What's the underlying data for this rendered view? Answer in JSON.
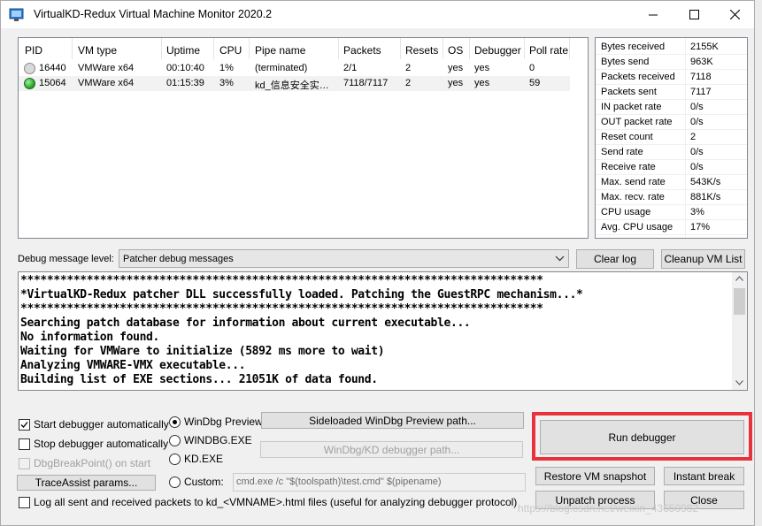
{
  "window": {
    "title": "VirtualKD-Redux Virtual Machine Monitor 2020.2",
    "controls": {
      "minimize": "—",
      "maximize": "☐",
      "close": "✕"
    }
  },
  "process_list": {
    "columns": [
      "PID",
      "VM type",
      "Uptime",
      "CPU",
      "Pipe name",
      "Packets",
      "Resets",
      "OS",
      "Debugger",
      "Poll rate"
    ],
    "rows": [
      {
        "status": "idle",
        "status_color": "#d9d9d9",
        "pid": "16440",
        "vm_type": "VMWare x64",
        "uptime": "00:10:40",
        "cpu": "1%",
        "pipe": "(terminated)",
        "packets": "2/1",
        "resets": "2",
        "os": "yes",
        "debugger": "yes",
        "poll_rate": "0"
      },
      {
        "status": "active",
        "status_color": "#2eaa2e",
        "pid": "15064",
        "vm_type": "VMWare x64",
        "uptime": "01:15:39",
        "cpu": "3%",
        "pipe": "kd_信息安全实…",
        "packets": "7118/7117",
        "resets": "2",
        "os": "yes",
        "debugger": "yes",
        "poll_rate": "59"
      }
    ]
  },
  "stats": [
    {
      "label": "Bytes received",
      "value": "2155K"
    },
    {
      "label": "Bytes send",
      "value": "963K"
    },
    {
      "label": "Packets received",
      "value": "7118"
    },
    {
      "label": "Packets sent",
      "value": "7117"
    },
    {
      "label": "IN packet rate",
      "value": "0/s"
    },
    {
      "label": "OUT packet rate",
      "value": "0/s"
    },
    {
      "label": "Reset count",
      "value": "2"
    },
    {
      "label": "Send rate",
      "value": "0/s"
    },
    {
      "label": "Receive rate",
      "value": "0/s"
    },
    {
      "label": "Max. send rate",
      "value": "543K/s"
    },
    {
      "label": "Max. recv. rate",
      "value": "881K/s"
    },
    {
      "label": "CPU usage",
      "value": "3%"
    },
    {
      "label": "Avg. CPU usage",
      "value": "17%"
    }
  ],
  "debug_level": {
    "label": "Debug message level:",
    "selected": "Patcher debug messages",
    "clear_log": "Clear log",
    "cleanup_vm_list": "Cleanup VM List"
  },
  "log": {
    "lines": [
      "*******************************************************************************",
      "*VirtualKD-Redux patcher DLL successfully loaded. Patching the GuestRPC mechanism...*",
      "*******************************************************************************",
      "Searching patch database for information about current executable...",
      "No information found.",
      "Waiting for VMWare to initialize (5892 ms more to wait)",
      "Analyzing VMWARE-VMX executable...",
      "Building list of EXE sections... 21051K of data found."
    ]
  },
  "options": {
    "start_debugger_auto": "Start debugger automatically",
    "stop_debugger_auto": "Stop debugger automatically",
    "dbgbreakpoint": "DbgBreakPoint() on start",
    "traceassist": "TraceAssist params...",
    "log_packets": "Log all sent and received packets to kd_<VMNAME>.html files (useful for analyzing debugger protocol)"
  },
  "debugger_choice": {
    "windbg_preview": "WinDbg Preview",
    "windbg_exe": "WINDBG.EXE",
    "kd_exe": "KD.EXE",
    "custom": "Custom:",
    "sideloaded_btn": "Sideloaded WinDbg Preview path...",
    "kd_path_btn": "WinDbg/KD debugger path...",
    "custom_cmd": "cmd.exe /c \"$(toolspath)\\test.cmd\" $(pipename)"
  },
  "actions": {
    "run_debugger": "Run debugger",
    "restore_snapshot": "Restore VM snapshot",
    "instant_break": "Instant break",
    "unpatch": "Unpatch process",
    "close": "Close"
  },
  "colors": {
    "highlight": "#e8323c",
    "active_dot": "#2eaa2e",
    "idle_dot": "#d9d9d9"
  },
  "watermark": "https://blog.csdn.net/weixin_43650982"
}
